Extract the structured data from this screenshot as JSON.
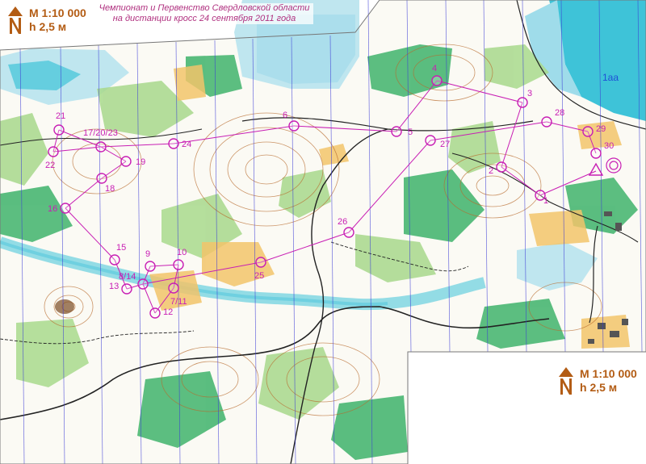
{
  "title": {
    "line1": "Чемпионат и Первенство Свердловской области",
    "line2": "на дистанции кросс 24 сентября 2011 года"
  },
  "scale_top": {
    "scale": "M 1:10 000",
    "contour": "h 2,5 м",
    "icon": "north-arrow-icon"
  },
  "scale_bottom": {
    "scale": "M 1:10 000",
    "contour": "h 2,5 м",
    "icon": "north-arrow-icon"
  },
  "map_label": "1aa",
  "controls": [
    {
      "label": "1"
    },
    {
      "label": "2"
    },
    {
      "label": "3"
    },
    {
      "label": "4"
    },
    {
      "label": "5"
    },
    {
      "label": "6"
    },
    {
      "label": "7/11"
    },
    {
      "label": "8/14"
    },
    {
      "label": "9"
    },
    {
      "label": "10"
    },
    {
      "label": "12"
    },
    {
      "label": "13"
    },
    {
      "label": "15"
    },
    {
      "label": "16"
    },
    {
      "label": "17/20/23"
    },
    {
      "label": "18"
    },
    {
      "label": "19"
    },
    {
      "label": "21"
    },
    {
      "label": "22"
    },
    {
      "label": "24"
    },
    {
      "label": "25"
    },
    {
      "label": "26"
    },
    {
      "label": "27"
    },
    {
      "label": "28"
    },
    {
      "label": "29"
    },
    {
      "label": "30"
    }
  ],
  "colors": {
    "course": "#c81eb4",
    "water": "#bfe6ef",
    "lake": "#3ec3d8",
    "forest_green": "#3fb36b",
    "light_green": "#a8d98c",
    "open_yellow": "#f2c46a",
    "contour": "#b86a2c",
    "north_lines": "#3b3bd6",
    "scale_text": "#b35c14"
  }
}
